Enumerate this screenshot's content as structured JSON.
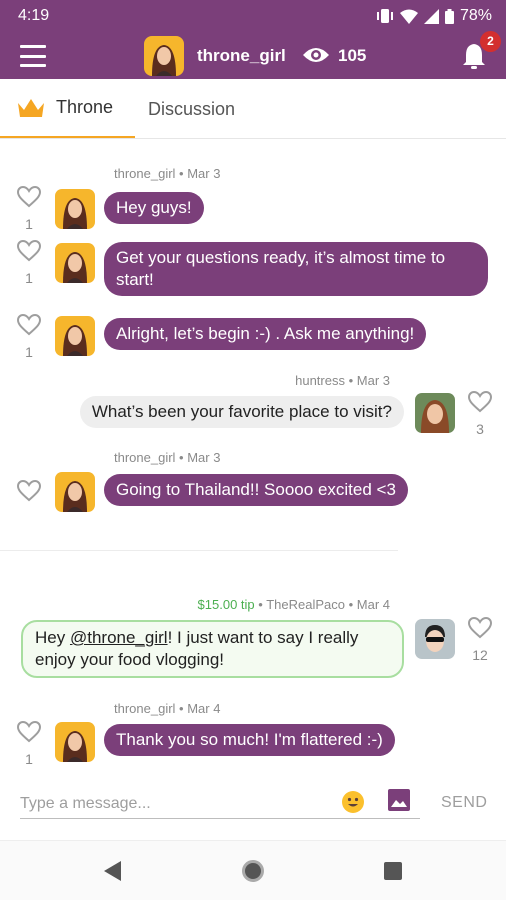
{
  "status_bar": {
    "time": "4:19",
    "battery": "78%"
  },
  "header": {
    "host_name": "throne_girl",
    "viewer_count": "105",
    "notification_count": "2"
  },
  "tabs": [
    {
      "label": "Throne"
    },
    {
      "label": "Discussion"
    }
  ],
  "messages": [
    {
      "user": "throne_girl",
      "date": "Mar 3",
      "text": "Hey guys!",
      "likes": "1"
    },
    {
      "text": "Get your questions ready, it’s almost time to start!",
      "likes": "1"
    },
    {
      "text": "Alright, let’s begin :-) . Ask me anything!",
      "likes": "1"
    },
    {
      "user": "huntress",
      "date": "Mar 3",
      "text": "What’s been your favorite place to visit?",
      "likes": "3"
    },
    {
      "user": "throne_girl",
      "date": "Mar 3",
      "text": "Going to Thailand!! Soooo excited <3"
    },
    {
      "tip": "$15.00 tip",
      "user": "TheRealPaco",
      "date": "Mar 4",
      "text_before": "Hey ",
      "mention": "@throne_girl",
      "text_after": "! I just want to say I really enjoy your food vlogging!",
      "likes": "12"
    },
    {
      "user": "throne_girl",
      "date": "Mar 4",
      "text": "Thank you so much! I'm flattered :-)",
      "likes": "1"
    }
  ],
  "composer": {
    "placeholder": "Type a message...",
    "send_label": "SEND"
  },
  "colors": {
    "brand_purple": "#7b3f7a",
    "tab_accent": "#f5a623",
    "tip_green": "#4caf50"
  }
}
